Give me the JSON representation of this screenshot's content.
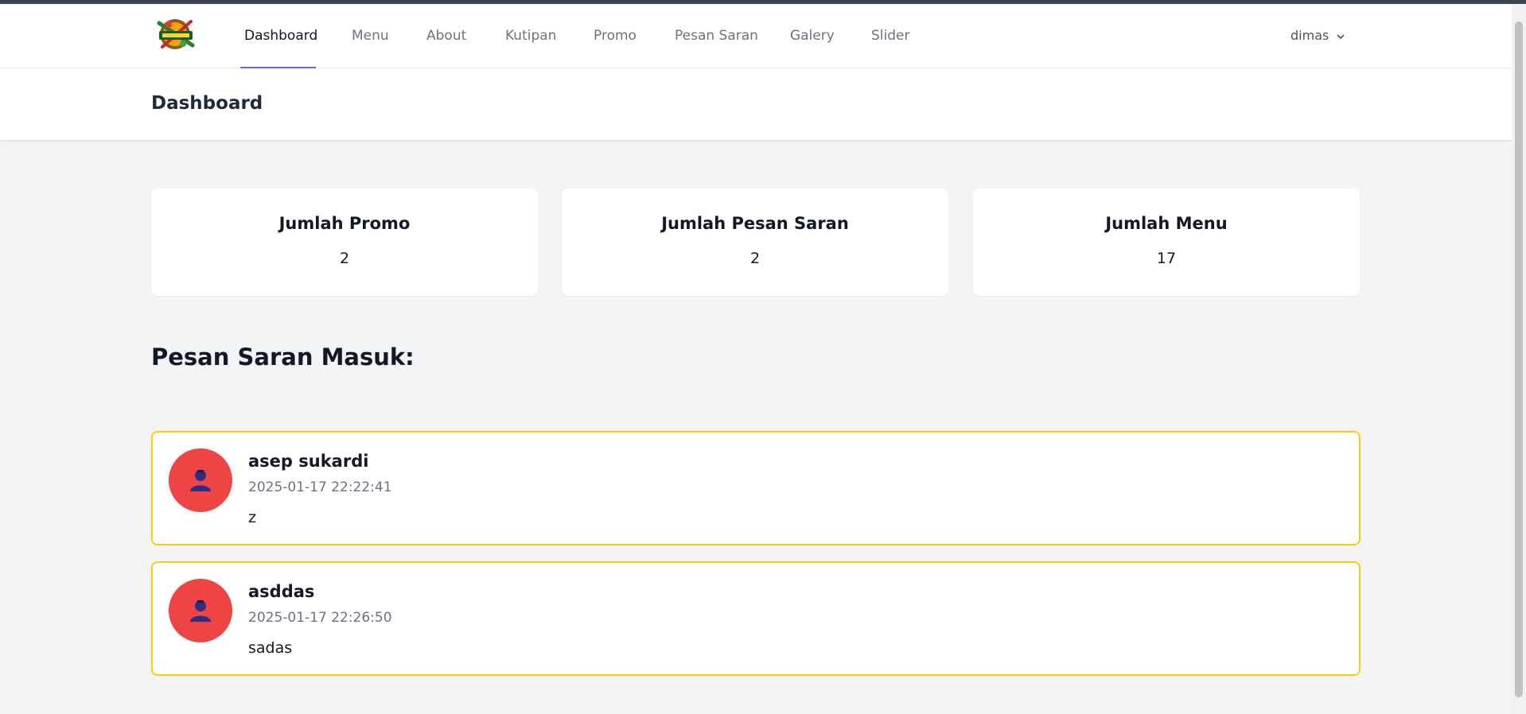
{
  "nav": {
    "items": [
      {
        "label": "Dashboard",
        "active": true
      },
      {
        "label": "Menu"
      },
      {
        "label": "About"
      },
      {
        "label": "Kutipan"
      },
      {
        "label": "Promo"
      },
      {
        "label": "Pesan Saran"
      },
      {
        "label": "Galery"
      },
      {
        "label": "Slider"
      }
    ],
    "user": "dimas",
    "accent": "#6366f1"
  },
  "header": {
    "title": "Dashboard"
  },
  "stats": [
    {
      "title": "Jumlah Promo",
      "value": "2"
    },
    {
      "title": "Jumlah Pesan Saran",
      "value": "2"
    },
    {
      "title": "Jumlah Menu",
      "value": "17"
    }
  ],
  "messages_section": {
    "title": "Pesan Saran Masuk:",
    "items": [
      {
        "name": "asep sukardi",
        "time": "2025-01-17 22:22:41",
        "text": "z"
      },
      {
        "name": "asddas",
        "time": "2025-01-17 22:26:50",
        "text": "sadas"
      }
    ]
  },
  "colors": {
    "card_border": "#facc15",
    "avatar_bg": "#ef4444",
    "page_bg": "#f3f4f6"
  }
}
